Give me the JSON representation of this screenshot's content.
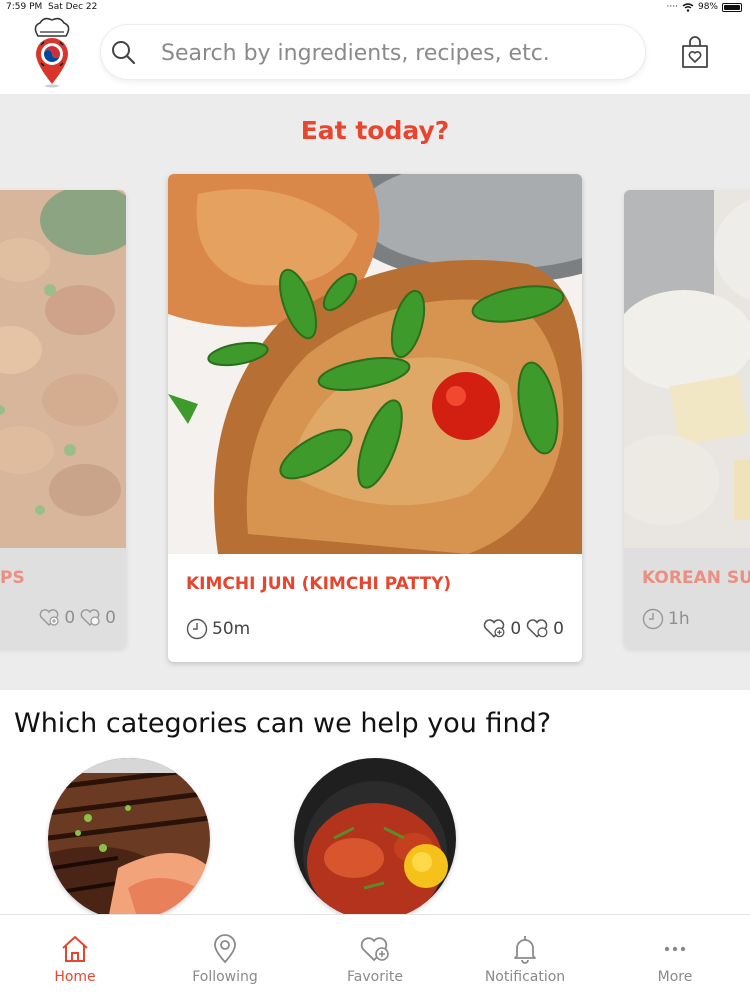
{
  "status_bar": {
    "time": "7:59 PM",
    "date": "Sat Dec 22",
    "battery": "98%",
    "battery_level": 0.98
  },
  "header": {
    "search_placeholder": "Search by ingredients, recipes, etc.",
    "logo_icon": "chef-korea-pin-logo",
    "bag_icon": "shopping-bag-heart-icon"
  },
  "hero": {
    "title": "Eat today?",
    "cards": [
      {
        "name": "PS",
        "time": "",
        "likes": "0",
        "favorites": "0"
      },
      {
        "name": "KIMCHI JUN (KIMCHI PATTY)",
        "time": "50m",
        "likes": "0",
        "favorites": "0"
      },
      {
        "name": "KOREAN SU",
        "time": "1h",
        "likes": "",
        "favorites": ""
      }
    ]
  },
  "categories": {
    "title": "Which categories can we help you find?",
    "items": [
      "bbq-ribs",
      "stew"
    ]
  },
  "tabbar": {
    "items": [
      {
        "label": "Home",
        "icon": "home-icon",
        "active": true
      },
      {
        "label": "Following",
        "icon": "location-pin-icon",
        "active": false
      },
      {
        "label": "Favorite",
        "icon": "heart-plus-icon",
        "active": false
      },
      {
        "label": "Notification",
        "icon": "bell-icon",
        "active": false
      },
      {
        "label": "More",
        "icon": "more-dots-icon",
        "active": false
      }
    ]
  },
  "colors": {
    "accent": "#e8452f",
    "hero_bg": "#ececec",
    "muted": "#8a8a8a"
  }
}
